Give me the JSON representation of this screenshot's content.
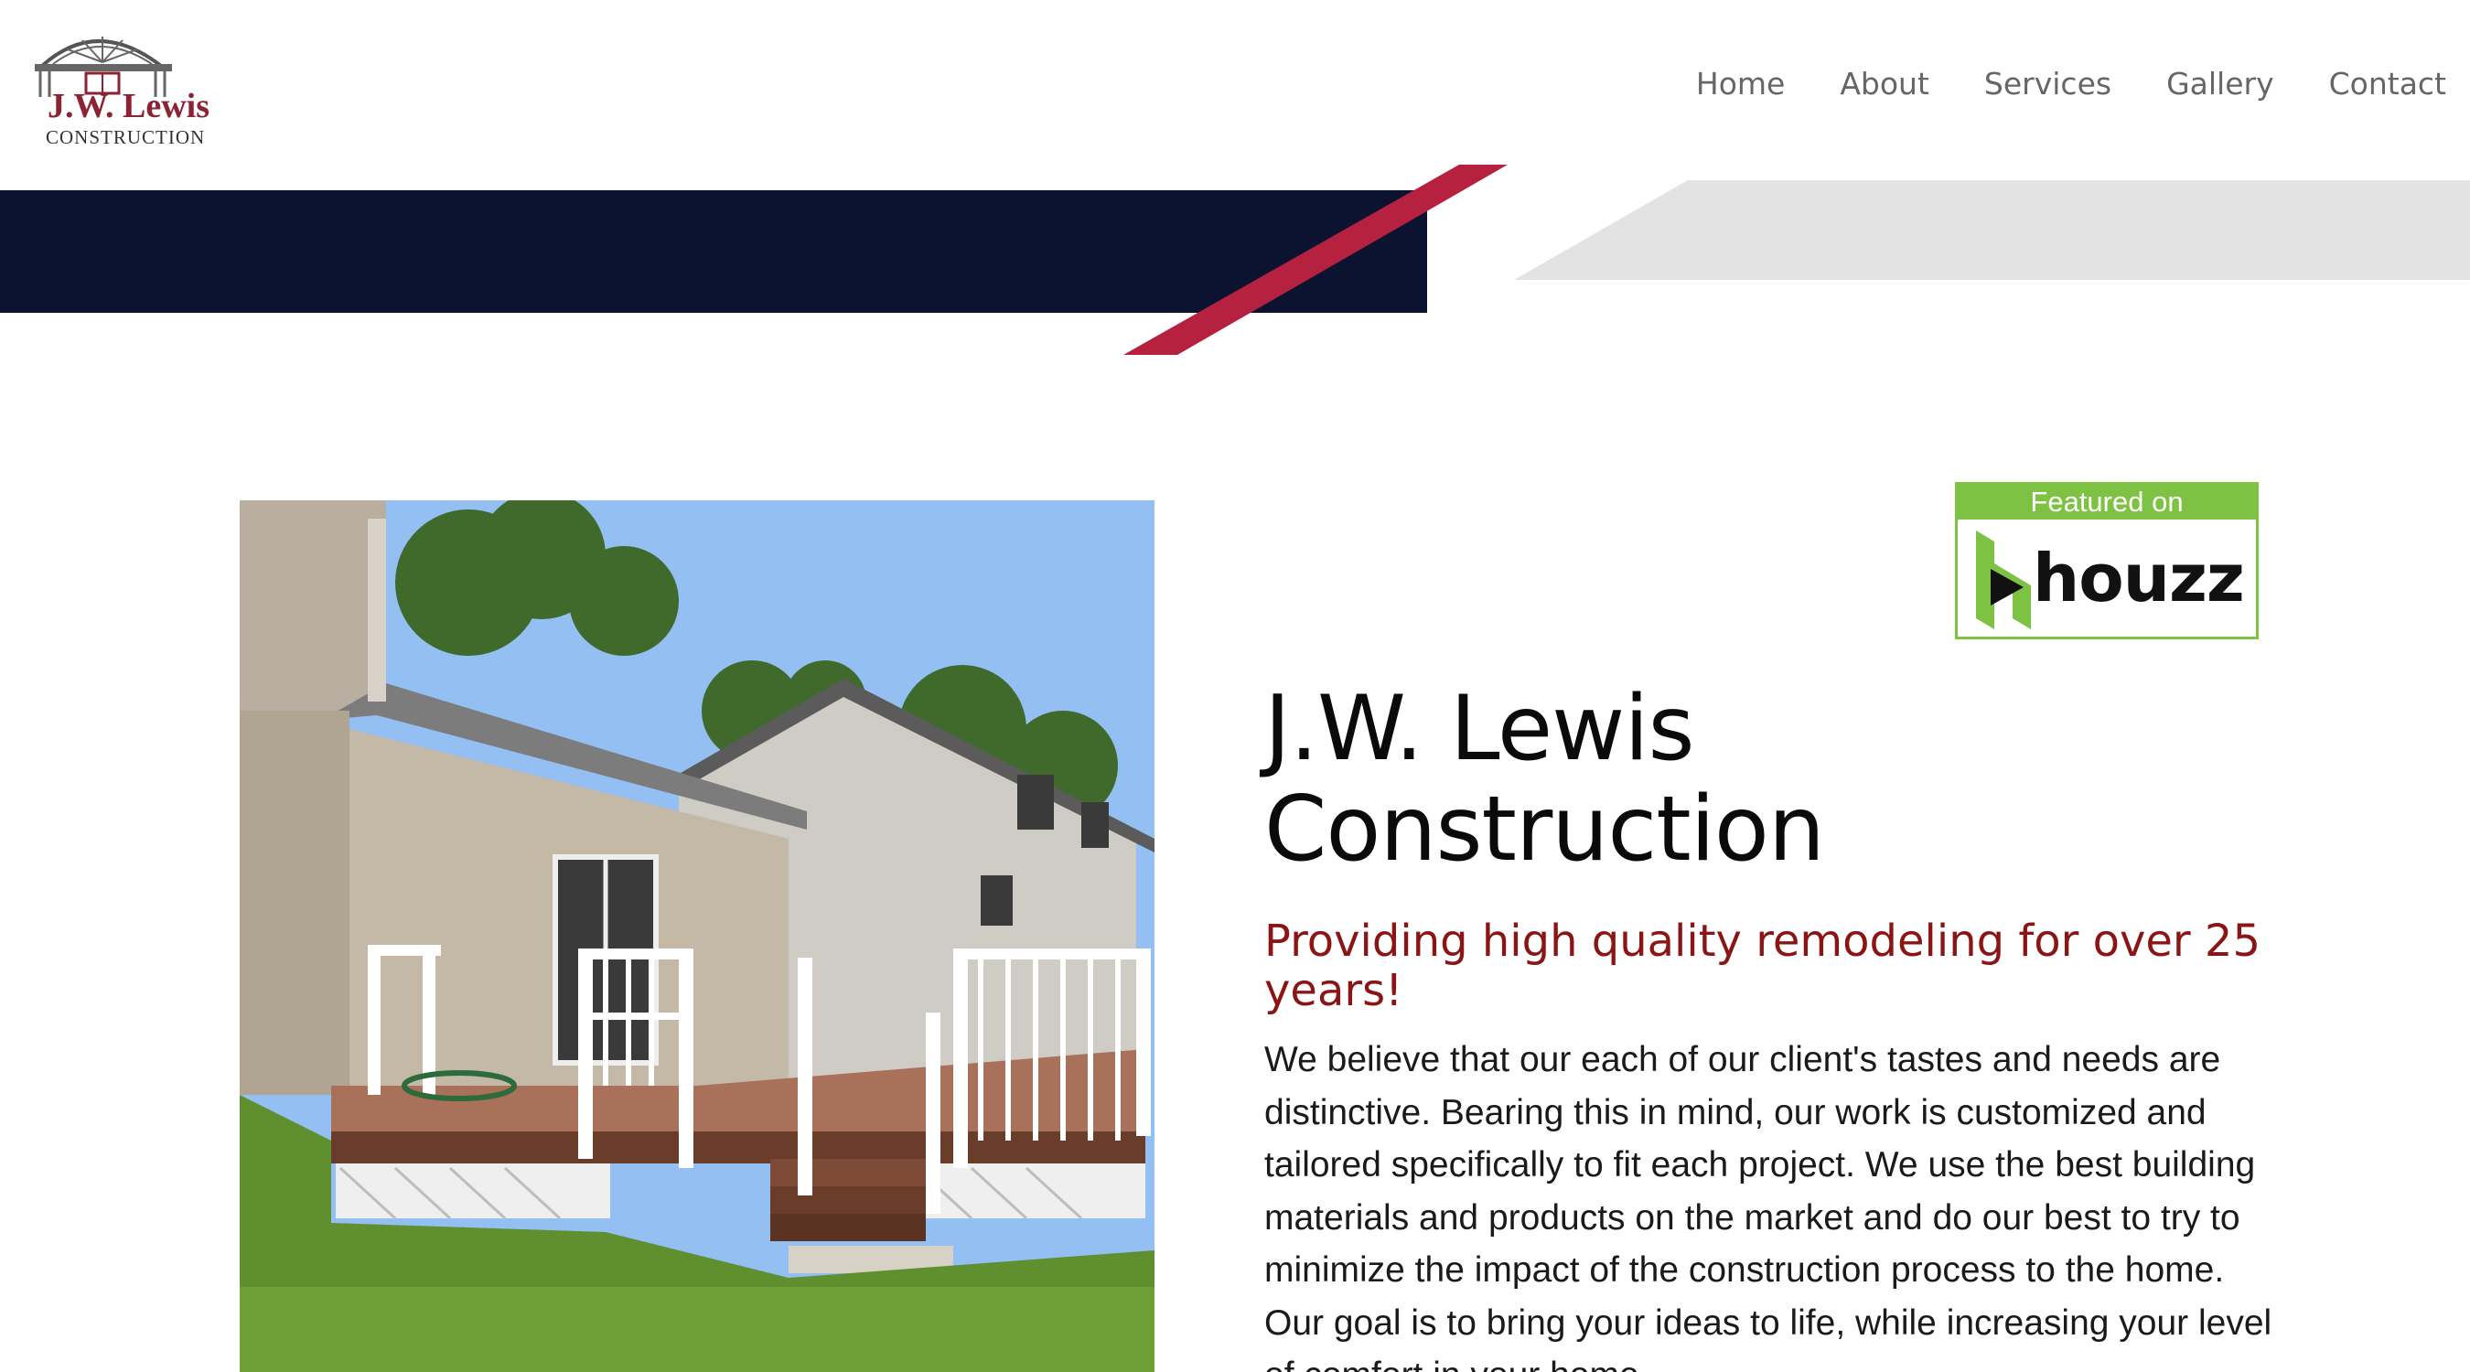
{
  "brand": {
    "name": "J.W. Lewis",
    "subline": "CONSTRUCTION"
  },
  "nav": {
    "items": [
      {
        "label": "Home"
      },
      {
        "label": "About"
      },
      {
        "label": "Services"
      },
      {
        "label": "Gallery"
      },
      {
        "label": "Contact"
      }
    ]
  },
  "badge": {
    "top_text": "Featured on",
    "word": "houzz"
  },
  "hero": {
    "title_line1": "J.W. Lewis",
    "title_line2": "Construction",
    "subtitle": "Providing high quality remodeling for over 25 years!",
    "body": "We believe that our each of our client's tastes and needs are distinctive. Bearing this in mind, our work is customized and tailored specifically to fit each project. We use the best building materials and products on the market and do our best to try to minimize the impact of the construction process to the home. Our goal is to bring your ideas to life, while increasing your level of comfort in your home."
  },
  "colors": {
    "navy": "#0b1330",
    "accent_red": "#b5213f",
    "light_gray": "#e3e3e3",
    "subtitle_red": "#8b1515",
    "houzz_green": "#7dc242"
  },
  "icons": {
    "logo": "house-gable-logo-icon",
    "houzz": "houzz-mark-icon"
  }
}
